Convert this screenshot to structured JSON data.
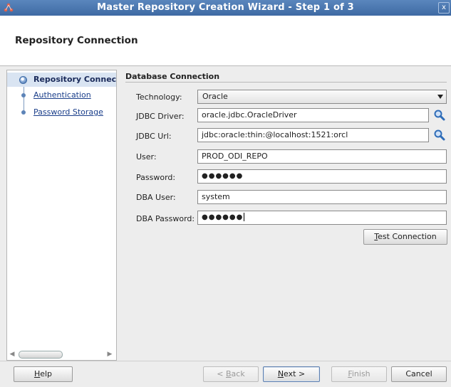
{
  "window": {
    "title": "Master Repository Creation Wizard - Step 1 of 3",
    "close_glyph": "x"
  },
  "header": {
    "title": "Repository Connection"
  },
  "steps": [
    {
      "label": "Repository Connection",
      "current": true
    },
    {
      "label": "Authentication",
      "current": false
    },
    {
      "label": "Password Storage",
      "current": false
    }
  ],
  "section": {
    "title": "Database Connection"
  },
  "form": {
    "technology": {
      "label": "Technology:",
      "value": "Oracle"
    },
    "jdbc_driver": {
      "label": "JDBC Driver:",
      "value": "oracle.jdbc.OracleDriver"
    },
    "jdbc_url": {
      "label": "JDBC Url:",
      "value": "jdbc:oracle:thin:@localhost:1521:orcl"
    },
    "user": {
      "label": "User:",
      "value": "PROD_ODI_REPO"
    },
    "password": {
      "label": "Password:",
      "value": "●●●●●●"
    },
    "dba_user": {
      "label": "DBA User:",
      "value": "system"
    },
    "dba_password": {
      "label": "DBA Password:",
      "value": "●●●●●●"
    }
  },
  "buttons": {
    "test_connection": {
      "mnemonic": "T",
      "rest": "est Connection"
    },
    "help": {
      "mnemonic": "H",
      "rest": "elp"
    },
    "back": {
      "prefix": "< ",
      "mnemonic": "B",
      "rest": "ack"
    },
    "next": {
      "mnemonic": "N",
      "rest": "ext >"
    },
    "finish": {
      "mnemonic": "F",
      "rest": "inish"
    },
    "cancel": {
      "label": "Cancel"
    }
  },
  "colors": {
    "titlebar": "#4a76af",
    "link": "#1a3e8a",
    "search_icon": "#2f6db8"
  }
}
